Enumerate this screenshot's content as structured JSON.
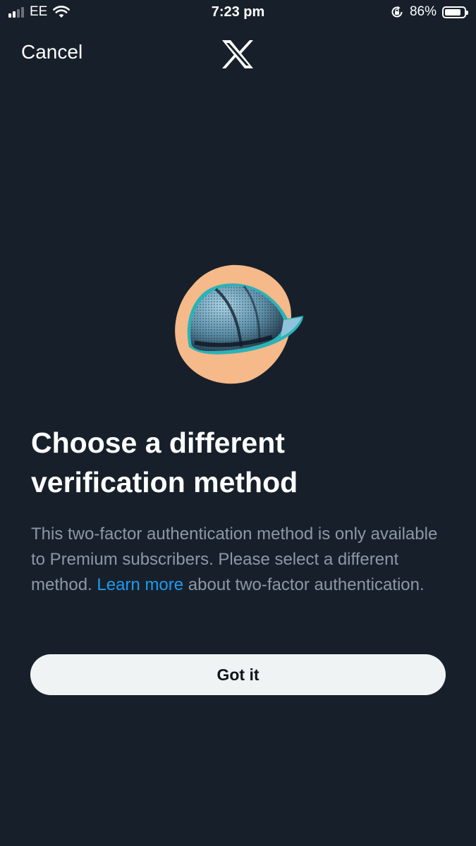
{
  "status_bar": {
    "carrier": "EE",
    "time": "7:23 pm",
    "battery_percent": "86%",
    "battery_level": 0.86,
    "icons": [
      "cellular-signal-icon",
      "wifi-icon",
      "rotation-lock-icon",
      "battery-icon"
    ]
  },
  "header": {
    "cancel_label": "Cancel",
    "logo": "x-logo-icon"
  },
  "illustration": {
    "icon": "hard-hat-illustration",
    "colors": {
      "backdrop": "#f5b98a",
      "helmet": "#6fa9c7",
      "outline": "#2bb3b8"
    }
  },
  "main": {
    "title": "Choose a different verification method",
    "body_before_link": "This two-factor authentication method is only available to Premium subscribers. Please select a different method. ",
    "link_text": "Learn more",
    "body_after_link": " about two-factor authentication.",
    "button_label": "Got it"
  },
  "colors": {
    "background": "#17202a",
    "link": "#1d9bf0",
    "button_bg": "#eff3f4",
    "secondary_text": "#8b98a5"
  }
}
